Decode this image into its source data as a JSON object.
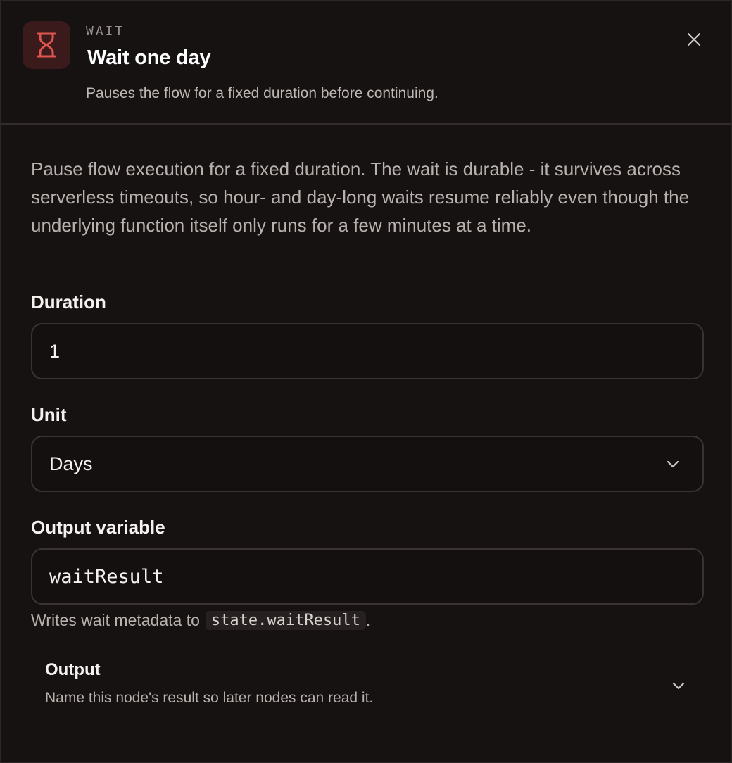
{
  "header": {
    "kicker": "WAIT",
    "title": "Wait one day",
    "subtitle": "Pauses the flow for a fixed duration before continuing."
  },
  "description": "Pause flow execution for a fixed duration. The wait is durable - it survives across serverless timeouts, so hour- and day-long waits resume reliably even though the underlying function itself only runs for a few minutes at a time.",
  "fields": {
    "duration": {
      "label": "Duration",
      "value": "1"
    },
    "unit": {
      "label": "Unit",
      "value": "Days"
    },
    "output_variable": {
      "label": "Output variable",
      "value": "waitResult"
    }
  },
  "helper": {
    "prefix": "Writes wait metadata to",
    "code": "state.waitResult",
    "suffix": "."
  },
  "output_section": {
    "title": "Output",
    "description": "Name this node's result so later nodes can read it."
  },
  "icons": {
    "node": "hourglass-icon",
    "close": "close-icon",
    "dropdown": "chevron-down-icon"
  },
  "colors": {
    "accent": "#e0554f",
    "background": "#161212"
  }
}
